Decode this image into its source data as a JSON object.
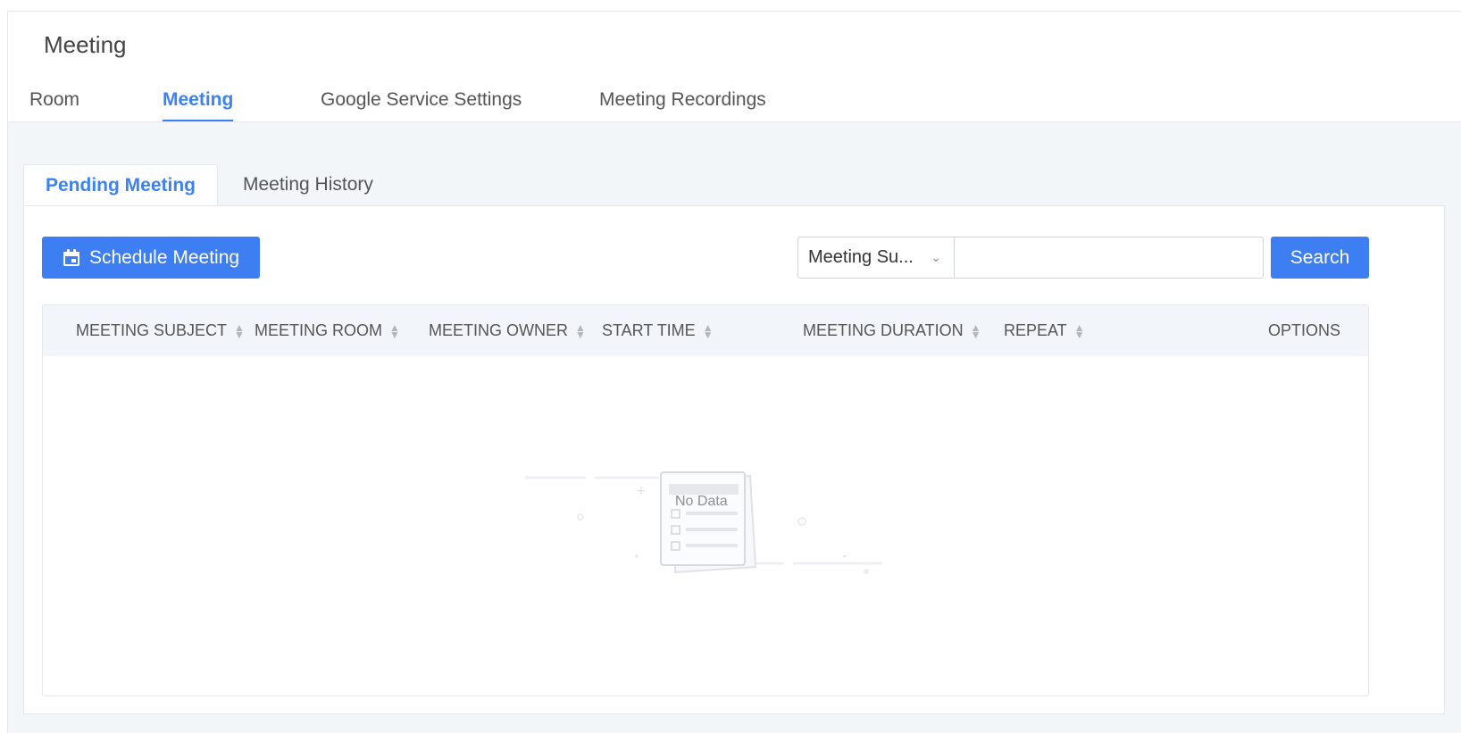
{
  "page": {
    "title": "Meeting"
  },
  "top_tabs": [
    {
      "label": "Room",
      "active": false
    },
    {
      "label": "Meeting",
      "active": true
    },
    {
      "label": "Google Service Settings",
      "active": false
    },
    {
      "label": "Meeting Recordings",
      "active": false
    }
  ],
  "sub_tabs": [
    {
      "label": "Pending Meeting",
      "active": true
    },
    {
      "label": "Meeting History",
      "active": false
    }
  ],
  "toolbar": {
    "schedule_label": "Schedule Meeting",
    "select_value": "Meeting Su...",
    "search_placeholder": "",
    "search_label": "Search"
  },
  "table": {
    "columns": [
      "MEETING SUBJECT",
      "MEETING ROOM",
      "MEETING OWNER",
      "START TIME",
      "MEETING DURATION",
      "REPEAT",
      "OPTIONS"
    ],
    "empty_text": "No Data"
  },
  "colors": {
    "accent": "#3d7ff2",
    "active_tab": "#3b82f6",
    "content_bg": "#f3f6f9"
  }
}
